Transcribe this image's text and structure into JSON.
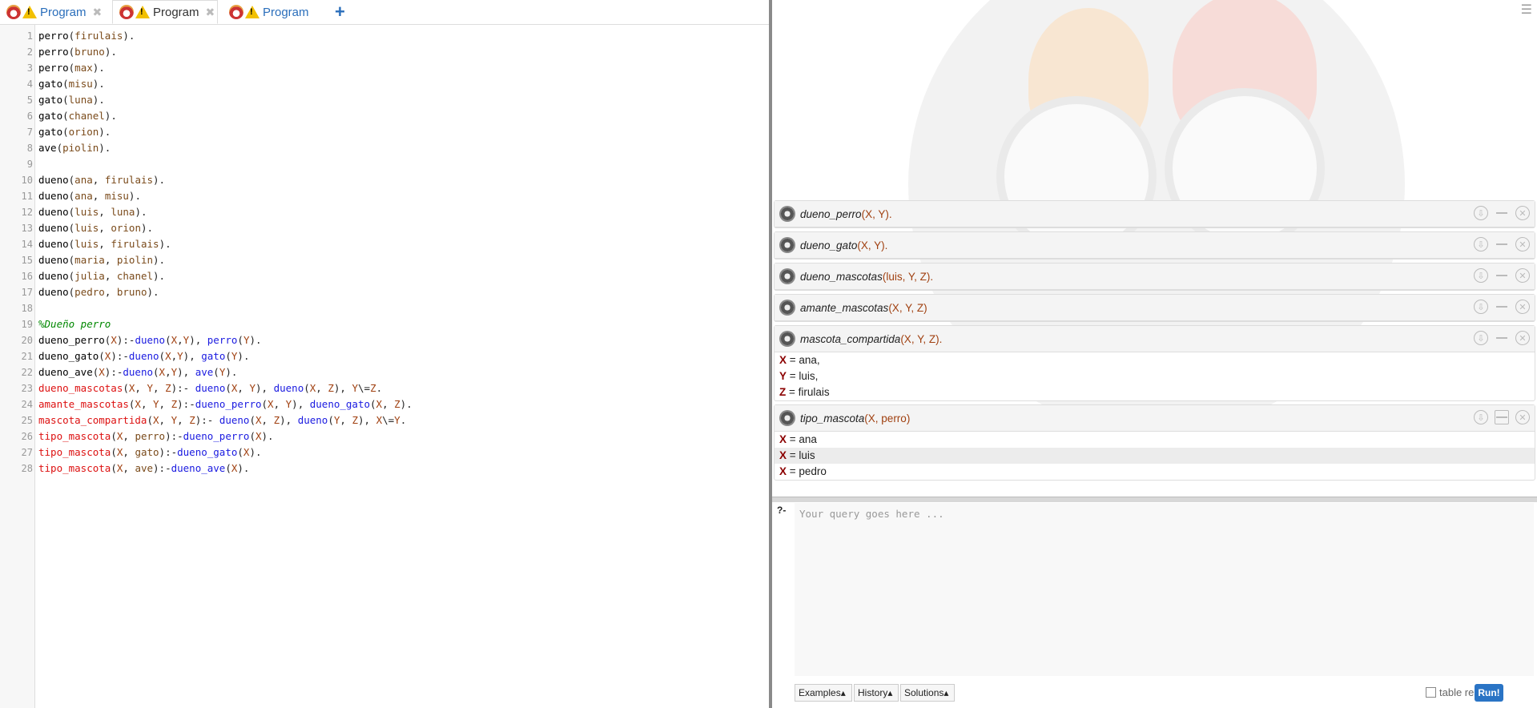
{
  "tabs": [
    {
      "label": "Program",
      "active": false
    },
    {
      "label": "Program",
      "active": true
    },
    {
      "label": "Program",
      "active": false
    }
  ],
  "tab_add": "+",
  "tab_close": "✖",
  "code_lines": [
    [
      [
        "pred",
        "perro"
      ],
      [
        "p",
        "("
      ],
      [
        "atom",
        "firulais"
      ],
      [
        "p",
        ")."
      ]
    ],
    [
      [
        "pred",
        "perro"
      ],
      [
        "p",
        "("
      ],
      [
        "atom",
        "bruno"
      ],
      [
        "p",
        ")."
      ]
    ],
    [
      [
        "pred",
        "perro"
      ],
      [
        "p",
        "("
      ],
      [
        "atom",
        "max"
      ],
      [
        "p",
        ")."
      ]
    ],
    [
      [
        "pred",
        "gato"
      ],
      [
        "p",
        "("
      ],
      [
        "atom",
        "misu"
      ],
      [
        "p",
        ")."
      ]
    ],
    [
      [
        "pred",
        "gato"
      ],
      [
        "p",
        "("
      ],
      [
        "atom",
        "luna"
      ],
      [
        "p",
        ")."
      ]
    ],
    [
      [
        "pred",
        "gato"
      ],
      [
        "p",
        "("
      ],
      [
        "atom",
        "chanel"
      ],
      [
        "p",
        ")."
      ]
    ],
    [
      [
        "pred",
        "gato"
      ],
      [
        "p",
        "("
      ],
      [
        "atom",
        "orion"
      ],
      [
        "p",
        ")."
      ]
    ],
    [
      [
        "pred",
        "ave"
      ],
      [
        "p",
        "("
      ],
      [
        "atom",
        "piolin"
      ],
      [
        "p",
        ")."
      ]
    ],
    [],
    [
      [
        "pred",
        "dueno"
      ],
      [
        "p",
        "("
      ],
      [
        "atom",
        "ana"
      ],
      [
        "p",
        ", "
      ],
      [
        "atom",
        "firulais"
      ],
      [
        "p",
        ")."
      ]
    ],
    [
      [
        "pred",
        "dueno"
      ],
      [
        "p",
        "("
      ],
      [
        "atom",
        "ana"
      ],
      [
        "p",
        ", "
      ],
      [
        "atom",
        "misu"
      ],
      [
        "p",
        ")."
      ]
    ],
    [
      [
        "pred",
        "dueno"
      ],
      [
        "p",
        "("
      ],
      [
        "atom",
        "luis"
      ],
      [
        "p",
        ", "
      ],
      [
        "atom",
        "luna"
      ],
      [
        "p",
        ")."
      ]
    ],
    [
      [
        "pred",
        "dueno"
      ],
      [
        "p",
        "("
      ],
      [
        "atom",
        "luis"
      ],
      [
        "p",
        ", "
      ],
      [
        "atom",
        "orion"
      ],
      [
        "p",
        ")."
      ]
    ],
    [
      [
        "pred",
        "dueno"
      ],
      [
        "p",
        "("
      ],
      [
        "atom",
        "luis"
      ],
      [
        "p",
        ", "
      ],
      [
        "atom",
        "firulais"
      ],
      [
        "p",
        ")."
      ]
    ],
    [
      [
        "pred",
        "dueno"
      ],
      [
        "p",
        "("
      ],
      [
        "atom",
        "maria"
      ],
      [
        "p",
        ", "
      ],
      [
        "atom",
        "piolin"
      ],
      [
        "p",
        ")."
      ]
    ],
    [
      [
        "pred",
        "dueno"
      ],
      [
        "p",
        "("
      ],
      [
        "atom",
        "julia"
      ],
      [
        "p",
        ", "
      ],
      [
        "atom",
        "chanel"
      ],
      [
        "p",
        ")."
      ]
    ],
    [
      [
        "pred",
        "dueno"
      ],
      [
        "p",
        "("
      ],
      [
        "atom",
        "pedro"
      ],
      [
        "p",
        ", "
      ],
      [
        "atom",
        "bruno"
      ],
      [
        "p",
        ")."
      ]
    ],
    [],
    [
      [
        "cmt",
        "%Dueño perro"
      ]
    ],
    [
      [
        "pred",
        "dueno_perro"
      ],
      [
        "p",
        "("
      ],
      [
        "var",
        "X"
      ],
      [
        "p",
        "):-"
      ],
      [
        "call",
        "dueno"
      ],
      [
        "p",
        "("
      ],
      [
        "var",
        "X"
      ],
      [
        "p",
        ","
      ],
      [
        "var",
        "Y"
      ],
      [
        "p",
        "), "
      ],
      [
        "call",
        "perro"
      ],
      [
        "p",
        "("
      ],
      [
        "var",
        "Y"
      ],
      [
        "p",
        ")."
      ]
    ],
    [
      [
        "pred",
        "dueno_gato"
      ],
      [
        "p",
        "("
      ],
      [
        "var",
        "X"
      ],
      [
        "p",
        "):-"
      ],
      [
        "call",
        "dueno"
      ],
      [
        "p",
        "("
      ],
      [
        "var",
        "X"
      ],
      [
        "p",
        ","
      ],
      [
        "var",
        "Y"
      ],
      [
        "p",
        "), "
      ],
      [
        "call",
        "gato"
      ],
      [
        "p",
        "("
      ],
      [
        "var",
        "Y"
      ],
      [
        "p",
        ")."
      ]
    ],
    [
      [
        "pred",
        "dueno_ave"
      ],
      [
        "p",
        "("
      ],
      [
        "var",
        "X"
      ],
      [
        "p",
        "):-"
      ],
      [
        "call",
        "dueno"
      ],
      [
        "p",
        "("
      ],
      [
        "var",
        "X"
      ],
      [
        "p",
        ","
      ],
      [
        "var",
        "Y"
      ],
      [
        "p",
        "), "
      ],
      [
        "call",
        "ave"
      ],
      [
        "p",
        "("
      ],
      [
        "var",
        "Y"
      ],
      [
        "p",
        ")."
      ]
    ],
    [
      [
        "head",
        "dueno_mascotas"
      ],
      [
        "p",
        "("
      ],
      [
        "var",
        "X"
      ],
      [
        "p",
        ", "
      ],
      [
        "var",
        "Y"
      ],
      [
        "p",
        ", "
      ],
      [
        "var",
        "Z"
      ],
      [
        "p",
        "):- "
      ],
      [
        "call",
        "dueno"
      ],
      [
        "p",
        "("
      ],
      [
        "var",
        "X"
      ],
      [
        "p",
        ", "
      ],
      [
        "var",
        "Y"
      ],
      [
        "p",
        "), "
      ],
      [
        "call",
        "dueno"
      ],
      [
        "p",
        "("
      ],
      [
        "var",
        "X"
      ],
      [
        "p",
        ", "
      ],
      [
        "var",
        "Z"
      ],
      [
        "p",
        "), "
      ],
      [
        "var",
        "Y"
      ],
      [
        "p",
        "\\="
      ],
      [
        "var",
        "Z"
      ],
      [
        "p",
        "."
      ]
    ],
    [
      [
        "head",
        "amante_mascotas"
      ],
      [
        "p",
        "("
      ],
      [
        "var",
        "X"
      ],
      [
        "p",
        ", "
      ],
      [
        "var",
        "Y"
      ],
      [
        "p",
        ", "
      ],
      [
        "var",
        "Z"
      ],
      [
        "p",
        "):-"
      ],
      [
        "call",
        "dueno_perro"
      ],
      [
        "p",
        "("
      ],
      [
        "var",
        "X"
      ],
      [
        "p",
        ", "
      ],
      [
        "var",
        "Y"
      ],
      [
        "p",
        "), "
      ],
      [
        "call",
        "dueno_gato"
      ],
      [
        "p",
        "("
      ],
      [
        "var",
        "X"
      ],
      [
        "p",
        ", "
      ],
      [
        "var",
        "Z"
      ],
      [
        "p",
        ")."
      ]
    ],
    [
      [
        "head",
        "mascota_compartida"
      ],
      [
        "p",
        "("
      ],
      [
        "var",
        "X"
      ],
      [
        "p",
        ", "
      ],
      [
        "var",
        "Y"
      ],
      [
        "p",
        ", "
      ],
      [
        "var",
        "Z"
      ],
      [
        "p",
        "):- "
      ],
      [
        "call",
        "dueno"
      ],
      [
        "p",
        "("
      ],
      [
        "var",
        "X"
      ],
      [
        "p",
        ", "
      ],
      [
        "var",
        "Z"
      ],
      [
        "p",
        "), "
      ],
      [
        "call",
        "dueno"
      ],
      [
        "p",
        "("
      ],
      [
        "var",
        "Y"
      ],
      [
        "p",
        ", "
      ],
      [
        "var",
        "Z"
      ],
      [
        "p",
        "), "
      ],
      [
        "var",
        "X"
      ],
      [
        "p",
        "\\="
      ],
      [
        "var",
        "Y"
      ],
      [
        "p",
        "."
      ]
    ],
    [
      [
        "head",
        "tipo_mascota"
      ],
      [
        "p",
        "("
      ],
      [
        "var",
        "X"
      ],
      [
        "p",
        ", "
      ],
      [
        "atom",
        "perro"
      ],
      [
        "p",
        "):-"
      ],
      [
        "call",
        "dueno_perro"
      ],
      [
        "p",
        "("
      ],
      [
        "var",
        "X"
      ],
      [
        "p",
        ")."
      ]
    ],
    [
      [
        "head",
        "tipo_mascota"
      ],
      [
        "p",
        "("
      ],
      [
        "var",
        "X"
      ],
      [
        "p",
        ", "
      ],
      [
        "atom",
        "gato"
      ],
      [
        "p",
        "):-"
      ],
      [
        "call",
        "dueno_gato"
      ],
      [
        "p",
        "("
      ],
      [
        "var",
        "X"
      ],
      [
        "p",
        ")."
      ]
    ],
    [
      [
        "head",
        "tipo_mascota"
      ],
      [
        "p",
        "("
      ],
      [
        "var",
        "X"
      ],
      [
        "p",
        ", "
      ],
      [
        "atom",
        "ave"
      ],
      [
        "p",
        "):-"
      ],
      [
        "call",
        "dueno_ave"
      ],
      [
        "p",
        "("
      ],
      [
        "var",
        "X"
      ],
      [
        "p",
        ")."
      ]
    ]
  ],
  "queries": [
    {
      "name": "dueno_perro",
      "args": "(X, Y).",
      "answers": []
    },
    {
      "name": "dueno_gato",
      "args": "(X, Y).",
      "answers": []
    },
    {
      "name": "dueno_mascotas",
      "args": "(luis, Y, Z).",
      "answers": []
    },
    {
      "name": "amante_mascotas",
      "args": "(X, Y, Z)",
      "answers": []
    },
    {
      "name": "mascota_compartida",
      "args": "(X, Y, Z).",
      "answers": [
        {
          "var": "X",
          "val": " = ana,",
          "hl": false
        },
        {
          "var": "Y",
          "val": " = luis,",
          "hl": false
        },
        {
          "var": "Z",
          "val": " = firulais",
          "hl": false
        }
      ]
    },
    {
      "name": "tipo_mascota",
      "args": "(X, perro)",
      "answers": [
        {
          "var": "X",
          "val": " = ana",
          "hl": false
        },
        {
          "var": "X",
          "val": " = luis",
          "hl": true
        },
        {
          "var": "X",
          "val": " = pedro",
          "hl": false
        }
      ]
    }
  ],
  "prompt": "?-",
  "query_placeholder": "Your query goes here ...",
  "buttons": {
    "examples": "Examples▴",
    "history": "History▴",
    "solutions": "Solutions▴",
    "table_results": "table results",
    "run": "Run!"
  },
  "menu_icon": "☰"
}
